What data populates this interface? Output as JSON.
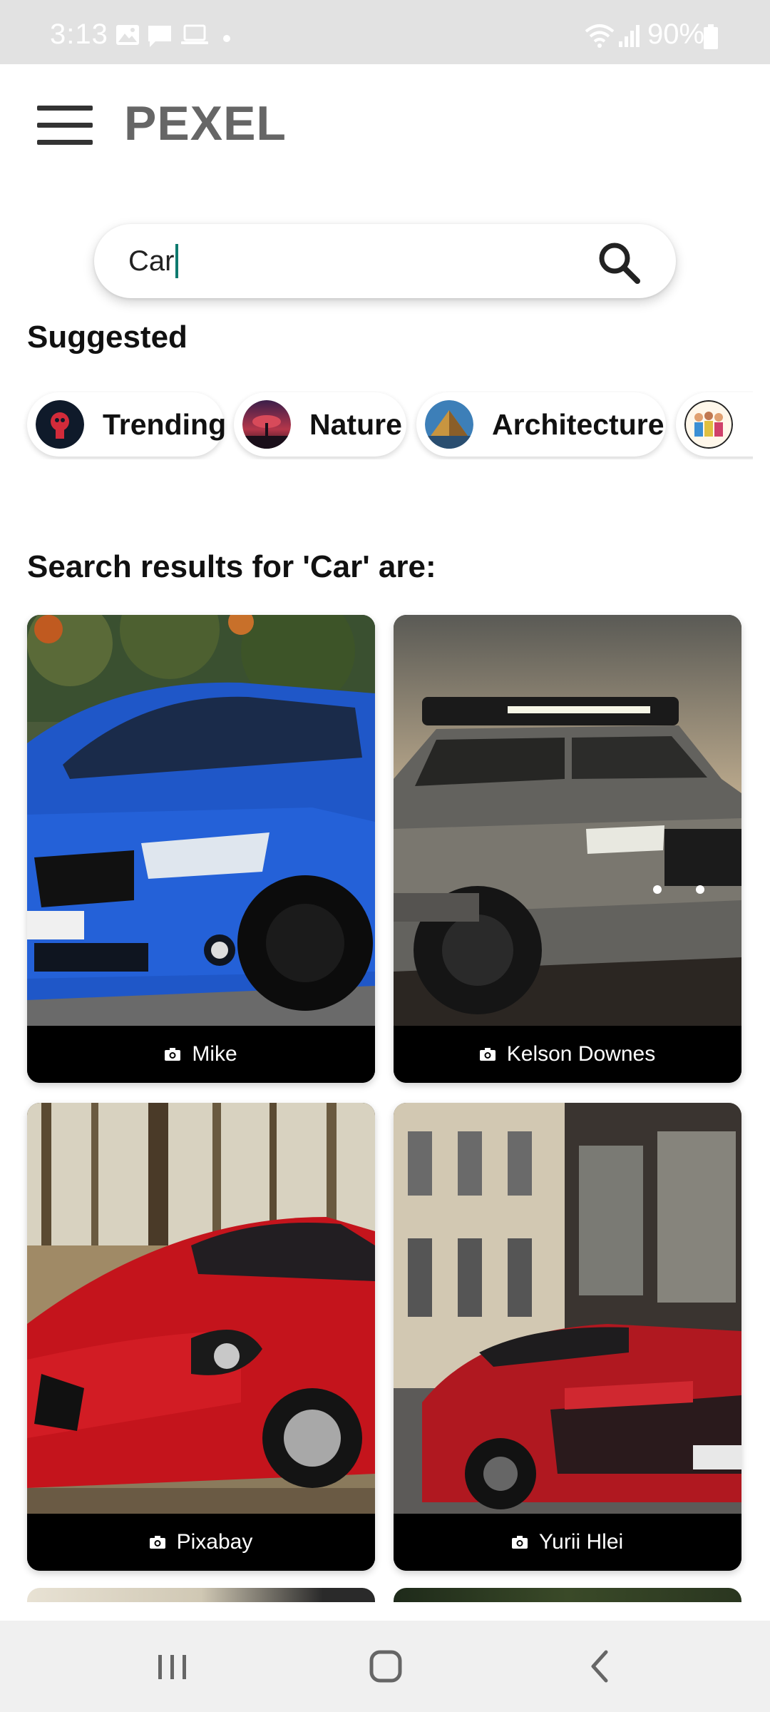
{
  "status_bar": {
    "time": "3:13",
    "battery": "90%"
  },
  "app": {
    "title": "PEXEL"
  },
  "search": {
    "value": "Car"
  },
  "suggested": {
    "heading": "Suggested",
    "chips": [
      {
        "label": "Trending",
        "icon": "trending-avatar"
      },
      {
        "label": "Nature",
        "icon": "nature-avatar"
      },
      {
        "label": "Architecture",
        "icon": "architecture-avatar"
      },
      {
        "label": "",
        "icon": "people-avatar"
      }
    ]
  },
  "results": {
    "heading": "Search results for 'Car' are:",
    "photos": [
      {
        "author": "Mike",
        "subject": "blue car"
      },
      {
        "author": "Kelson Downes",
        "subject": "grey truck"
      },
      {
        "author": "Pixabay",
        "subject": "red sports car"
      },
      {
        "author": "Yurii Hlei",
        "subject": "red supercar"
      }
    ]
  },
  "colors": {
    "accent_caret": "#0e7a6f",
    "title_gray": "#666666",
    "status_bar_bg": "#e2e2e2"
  }
}
